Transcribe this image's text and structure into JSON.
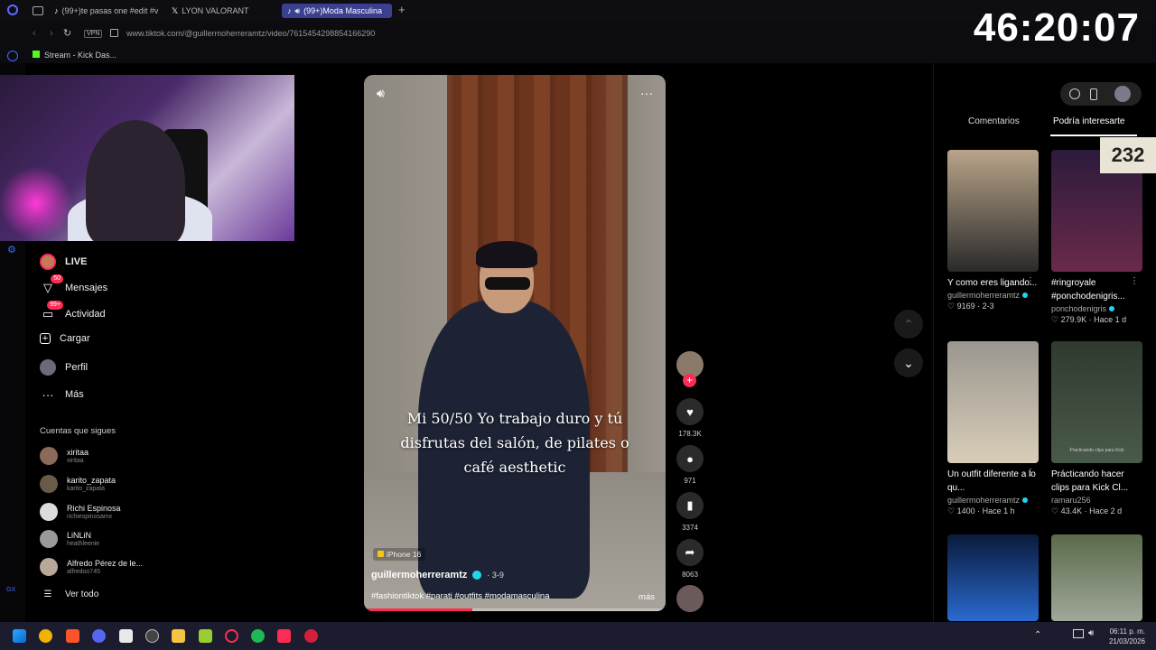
{
  "browser": {
    "tabs": [
      {
        "label": "(99+)te pasas one #edit #v"
      },
      {
        "label": "LYON VALORANT"
      },
      {
        "label": "(99+)Moda Masculina"
      }
    ],
    "vpn_label": "VPN",
    "url": "www.tiktok.com/@guillermoherreramtz/video/7615454298854166290",
    "bookmark": "Stream - Kick Das..."
  },
  "overlay": {
    "timer": "46:20:07",
    "counter": "232"
  },
  "sidebar": {
    "nav": [
      {
        "label": "LIVE",
        "icon": "live-avatar-icon",
        "badge": ""
      },
      {
        "label": "Mensajes",
        "icon": "message-icon",
        "badge": "50"
      },
      {
        "label": "Actividad",
        "icon": "activity-icon",
        "badge": "99+"
      },
      {
        "label": "Cargar",
        "icon": "upload-icon",
        "badge": ""
      },
      {
        "label": "Perfil",
        "icon": "profile-avatar-icon",
        "badge": ""
      },
      {
        "label": "Más",
        "icon": "more-icon",
        "badge": ""
      }
    ],
    "following_title": "Cuentas que sigues",
    "following": [
      {
        "name": "xiritaa",
        "handle": "xiritaa"
      },
      {
        "name": "karito_zapata",
        "handle": "karito_zapata"
      },
      {
        "name": "Richi Espinosa",
        "handle": "richiespinosamx"
      },
      {
        "name": "LiNLiN",
        "handle": "heathleenie"
      },
      {
        "name": "Alfredo Pérez de le...",
        "handle": "alfredoo745"
      }
    ],
    "see_all": "Ver todo"
  },
  "video": {
    "caption": "Mi 50/50 Yo trabajo duro y tú disfrutas del salón, de pilates o café aesthetic",
    "device_tag": "iPhone 16",
    "author": "guillermoherreramtz",
    "date": "· 3-9",
    "hashtags": "#fashiontiktok #parati #outfits #modamasculina",
    "more": "más",
    "progress": 0.36
  },
  "actions": {
    "likes": "178.3K",
    "comments": "971",
    "saves": "3374",
    "shares": "8063"
  },
  "right_panel": {
    "tabs": [
      "Comentarios",
      "Podría interesarte"
    ],
    "cards": [
      {
        "title": "Y como eres ligando...",
        "user": "guillermoherreramtz",
        "stats": "♡ 9169 · 2-3",
        "colors": [
          "#b9a489",
          "#2a2a2a"
        ]
      },
      {
        "title": "#ringroyale #ponchodenigris...",
        "user": "ponchodenigris",
        "stats": "♡ 279.9K · Hace 1 d",
        "colors": [
          "#2c1a3c",
          "#6a2a4a"
        ]
      },
      {
        "title": "Un outfit diferente a lo qu...",
        "user": "guillermoherreramtz",
        "stats": "♡ 1400 · Hace 1 h",
        "colors": [
          "#9a968f",
          "#d8cdb8"
        ]
      },
      {
        "title": "Prácticando hacer clips para Kick Cl...",
        "user": "ramaru256",
        "stats": "♡ 43.4K · Hace 2 d",
        "colors": [
          "#2f3a2f",
          "#4a5a4a"
        ]
      },
      {
        "title": "",
        "user": "",
        "stats": "",
        "colors": [
          "#0a1a3a",
          "#2a6ad0"
        ]
      },
      {
        "title": "",
        "user": "",
        "stats": "",
        "colors": [
          "#5a6a4a",
          "#a0a89a"
        ]
      }
    ],
    "thumb_caption": "Practicando clips para Kick"
  },
  "taskbar": {
    "time": "06:11 p. m.",
    "date": "21/03/2026"
  }
}
